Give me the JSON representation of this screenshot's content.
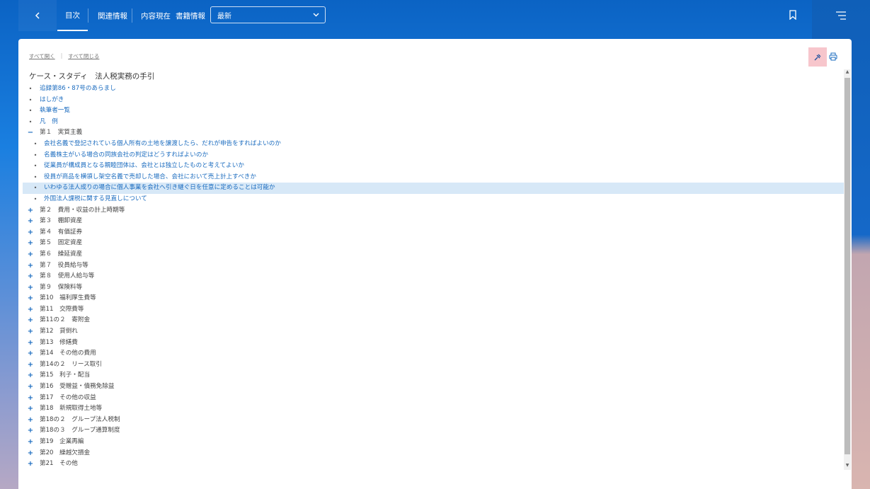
{
  "header": {
    "back_icon": "chevron-left-icon",
    "tabs": [
      {
        "label": "目次",
        "active": true
      },
      {
        "label": "関連情報",
        "active": false
      },
      {
        "label": "内容現在",
        "active": false
      },
      {
        "label": "書籍情報",
        "active": false
      }
    ],
    "version_select": {
      "value": "最新"
    },
    "bookmark_icon": "bookmark-icon",
    "menu_icon": "menu-icon"
  },
  "toolbar": {
    "expand_all": "すべて開く",
    "collapse_all": "すべて閉じる",
    "pin_icon": "pin-icon",
    "print_icon": "print-icon"
  },
  "book": {
    "title": "ケース・スタディ　法人税実務の手引"
  },
  "toc": [
    {
      "marker": "bullet",
      "level": 0,
      "style": "link",
      "text": "追録第86・87号のあらまし"
    },
    {
      "marker": "bullet",
      "level": 0,
      "style": "link",
      "text": "はしがき"
    },
    {
      "marker": "bullet",
      "level": 0,
      "style": "link",
      "text": "執筆者一覧"
    },
    {
      "marker": "bullet",
      "level": 0,
      "style": "link",
      "text": "凡　例"
    },
    {
      "marker": "minus",
      "level": 0,
      "style": "plain",
      "text": "第１　実質主義"
    },
    {
      "marker": "bullet",
      "level": 1,
      "style": "link",
      "text": "会社名義で登記されている個人所有の土地を譲渡したら、だれが申告をすればよいのか"
    },
    {
      "marker": "bullet",
      "level": 1,
      "style": "link",
      "text": "名義株主がいる場合の同族会社の判定はどうすればよいのか"
    },
    {
      "marker": "bullet",
      "level": 1,
      "style": "link",
      "text": "従業員が構成員となる親睦団体は、会社とは独立したものと考えてよいか"
    },
    {
      "marker": "bullet",
      "level": 1,
      "style": "link",
      "text": "役員が商品を横領し架空名義で売却した場合、会社において売上計上すべきか"
    },
    {
      "marker": "bullet",
      "level": 1,
      "style": "link",
      "text": "いわゆる法人成りの場合に個人事業を会社へ引き継ぐ日を任意に定めることは可能か",
      "selected": true
    },
    {
      "marker": "bullet",
      "level": 1,
      "style": "link",
      "text": "外国法人課税に関する見直しについて"
    },
    {
      "marker": "plus",
      "level": 0,
      "style": "plain",
      "text": "第２　費用・収益の計上時期等"
    },
    {
      "marker": "plus",
      "level": 0,
      "style": "plain",
      "text": "第３　棚卸資産"
    },
    {
      "marker": "plus",
      "level": 0,
      "style": "plain",
      "text": "第４　有価証券"
    },
    {
      "marker": "plus",
      "level": 0,
      "style": "plain",
      "text": "第５　固定資産"
    },
    {
      "marker": "plus",
      "level": 0,
      "style": "plain",
      "text": "第６　繰延資産"
    },
    {
      "marker": "plus",
      "level": 0,
      "style": "plain",
      "text": "第７　役員給与等"
    },
    {
      "marker": "plus",
      "level": 0,
      "style": "plain",
      "text": "第８　使用人給与等"
    },
    {
      "marker": "plus",
      "level": 0,
      "style": "plain",
      "text": "第９　保険料等"
    },
    {
      "marker": "plus",
      "level": 0,
      "style": "plain",
      "text": "第10　福利厚生費等"
    },
    {
      "marker": "plus",
      "level": 0,
      "style": "plain",
      "text": "第11　交際費等"
    },
    {
      "marker": "plus",
      "level": 0,
      "style": "plain",
      "text": "第11の２　寄附金"
    },
    {
      "marker": "plus",
      "level": 0,
      "style": "plain",
      "text": "第12　貸倒れ"
    },
    {
      "marker": "plus",
      "level": 0,
      "style": "plain",
      "text": "第13　修繕費"
    },
    {
      "marker": "plus",
      "level": 0,
      "style": "plain",
      "text": "第14　その他の費用"
    },
    {
      "marker": "plus",
      "level": 0,
      "style": "plain",
      "text": "第14の２　リース取引"
    },
    {
      "marker": "plus",
      "level": 0,
      "style": "plain",
      "text": "第15　利子・配当"
    },
    {
      "marker": "plus",
      "level": 0,
      "style": "plain",
      "text": "第16　受贈益・債務免除益"
    },
    {
      "marker": "plus",
      "level": 0,
      "style": "plain",
      "text": "第17　その他の収益"
    },
    {
      "marker": "plus",
      "level": 0,
      "style": "plain",
      "text": "第18　新規取得土地等"
    },
    {
      "marker": "plus",
      "level": 0,
      "style": "plain",
      "text": "第18の２　グループ法人税制"
    },
    {
      "marker": "plus",
      "level": 0,
      "style": "plain",
      "text": "第18の３　グループ通算制度"
    },
    {
      "marker": "plus",
      "level": 0,
      "style": "plain",
      "text": "第19　企業再編"
    },
    {
      "marker": "plus",
      "level": 0,
      "style": "plain",
      "text": "第20　繰越欠損金"
    },
    {
      "marker": "plus",
      "level": 0,
      "style": "plain",
      "text": "第21　その他"
    }
  ]
}
